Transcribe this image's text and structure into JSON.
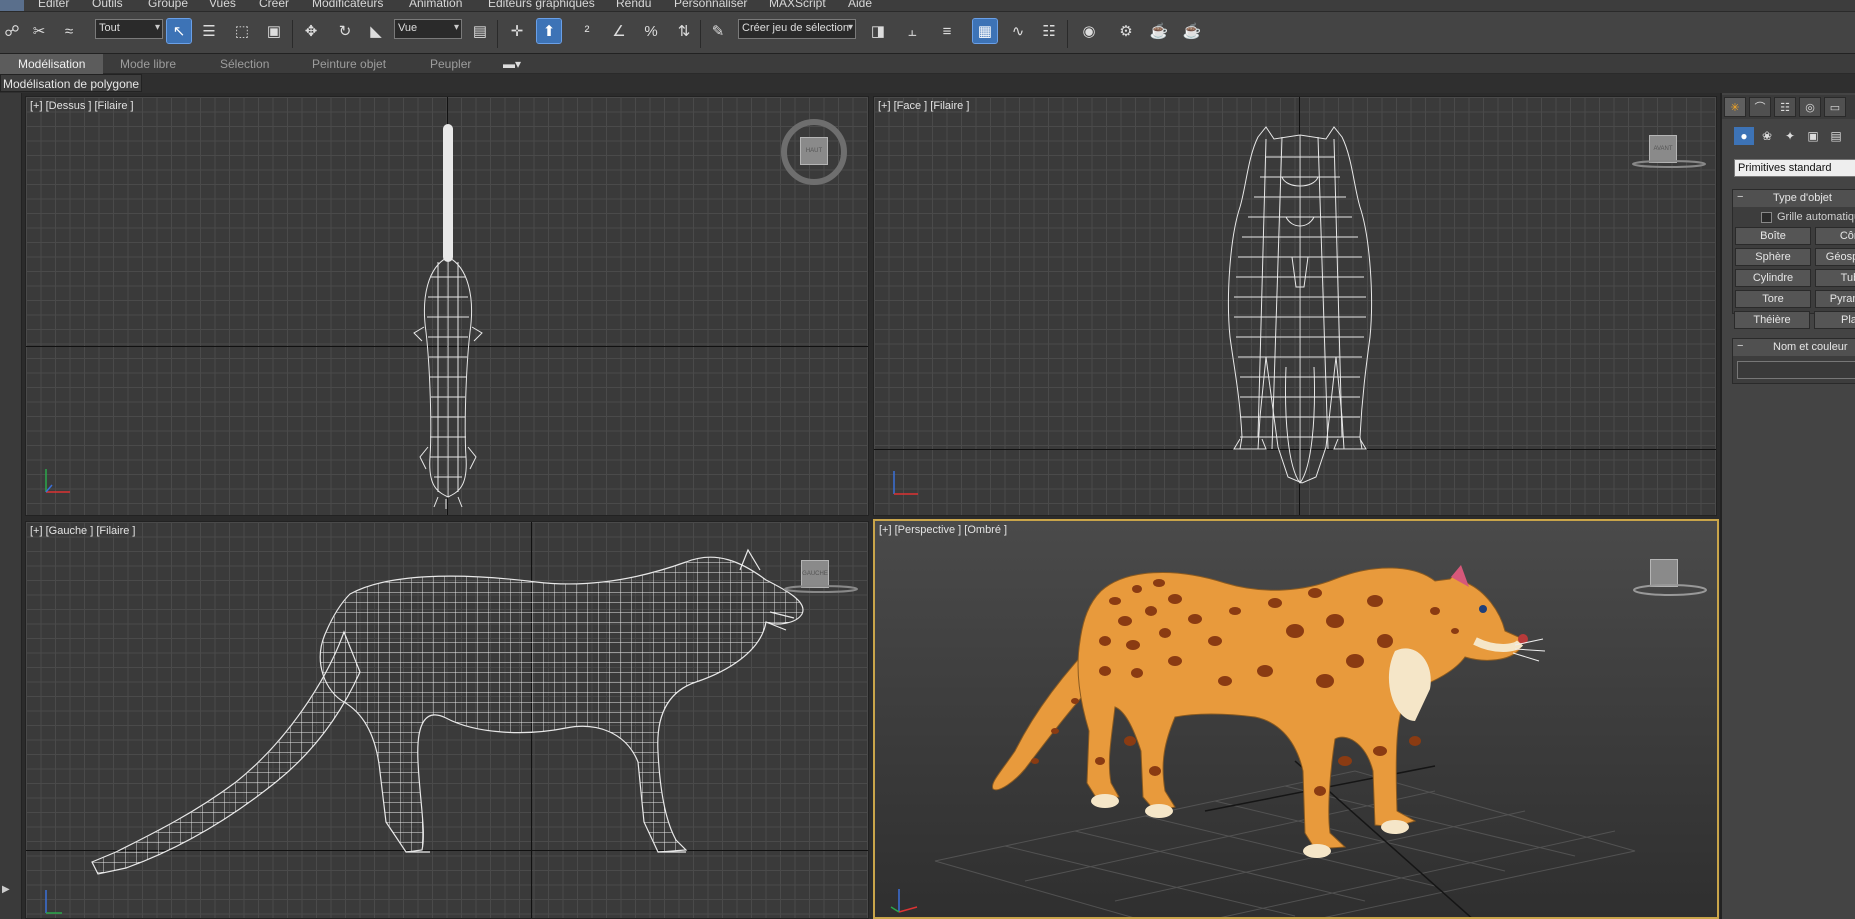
{
  "menubar": {
    "items": [
      "Editer",
      "Outils",
      "Groupe",
      "Vues",
      "Créer",
      "Modificateurs",
      "Animation",
      "Editeurs graphiques",
      "Rendu",
      "Personnaliser",
      "MAXScript",
      "Aide"
    ]
  },
  "toolbar": {
    "selection_filter": "Tout",
    "ref_coord": "Vue",
    "named_selection_placeholder": "Créer jeu de sélection"
  },
  "ribbon": {
    "tabs": [
      "Modélisation",
      "Mode libre",
      "Sélection",
      "Peinture objet",
      "Peupler"
    ],
    "active_tab": "Modélisation",
    "sub_label": "Modélisation de polygone"
  },
  "viewports": {
    "top": {
      "label": "[+] [Dessus ] [Filaire ]",
      "cube_text": "HAUT"
    },
    "front": {
      "label": "[+] [Face ] [Filaire ]",
      "cube_text": "AVANT"
    },
    "left": {
      "label": "[+] [Gauche ] [Filaire ]",
      "cube_text": "GAUCHE"
    },
    "perspective": {
      "label": "[+] [Perspective ] [Ombré ]"
    }
  },
  "command_panel": {
    "category": "Primitives standard",
    "object_type_title": "Type d'objet",
    "autogrid_label": "Grille automatique",
    "buttons": [
      "Boîte",
      "Cône",
      "Sphère",
      "Géosphère",
      "Cylindre",
      "Tube",
      "Tore",
      "Pyramide",
      "Théière",
      "Plan"
    ],
    "name_color_title": "Nom et couleur"
  },
  "colors": {
    "accent_active": "#3d73b6",
    "perspective_border": "#c9a54a",
    "leopard_body": "#e89a3c",
    "leopard_spots": "#8a3b12"
  }
}
